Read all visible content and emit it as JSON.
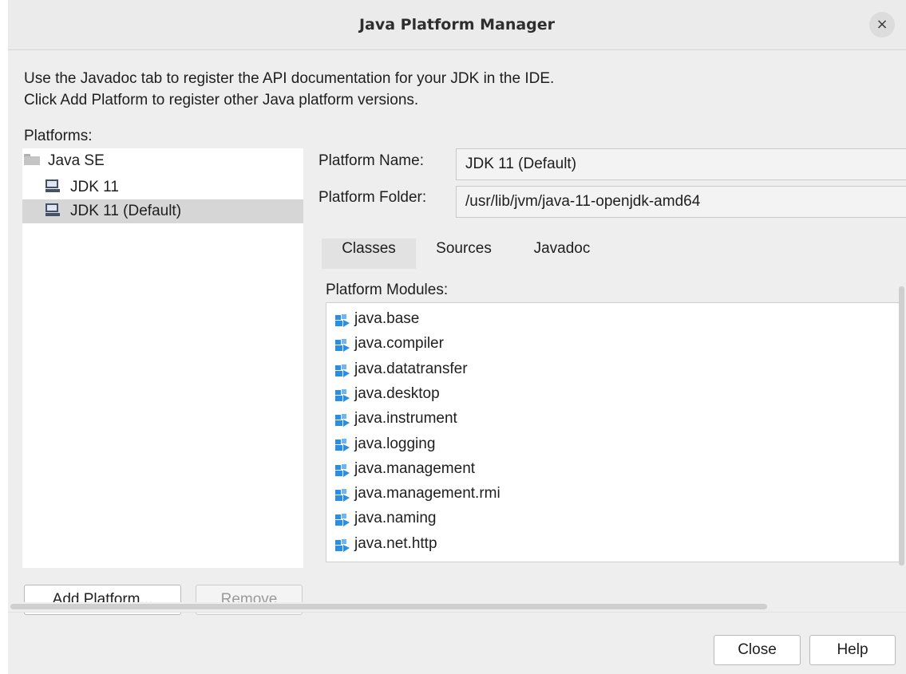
{
  "window": {
    "title": "Java Platform Manager",
    "close_glyph": "×"
  },
  "intro": {
    "line1": "Use the Javadoc tab to register the API documentation for your JDK in the IDE.",
    "line2": "Click Add Platform to register other Java platform versions."
  },
  "platforms": {
    "label": "Platforms:",
    "tree": [
      {
        "label": "Java SE",
        "icon": "folder-icon",
        "selected": false
      },
      {
        "label": "JDK 11",
        "icon": "monitor-icon",
        "selected": false
      },
      {
        "label": "JDK 11 (Default)",
        "icon": "monitor-icon",
        "selected": true
      }
    ]
  },
  "details": {
    "name_label": "Platform Name:",
    "name_value": "JDK 11 (Default)",
    "folder_label": "Platform Folder:",
    "folder_value": "/usr/lib/jvm/java-11-openjdk-amd64"
  },
  "tabs": [
    {
      "label": "Classes",
      "active": true
    },
    {
      "label": "Sources",
      "active": false
    },
    {
      "label": "Javadoc",
      "active": false
    }
  ],
  "modules": {
    "label": "Platform Modules:",
    "items": [
      "java.base",
      "java.compiler",
      "java.datatransfer",
      "java.desktop",
      "java.instrument",
      "java.logging",
      "java.management",
      "java.management.rmi",
      "java.naming",
      "java.net.http"
    ]
  },
  "buttons": {
    "add_platform": "Add Platform...",
    "remove": "Remove",
    "close": "Close",
    "help": "Help"
  },
  "colors": {
    "window_bg": "#eeeeee",
    "selection": "#d6d6d6",
    "module_icon": "#2a8fe0"
  }
}
